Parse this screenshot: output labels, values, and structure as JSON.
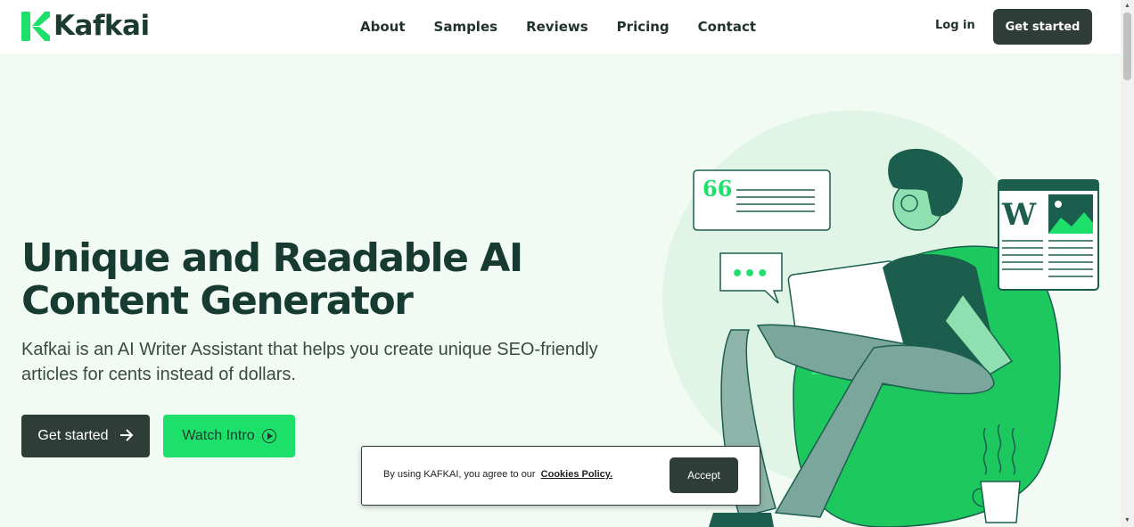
{
  "brand": {
    "name": "Kafkai",
    "accent": "#1de06b",
    "dark": "#2f3d38"
  },
  "nav": {
    "items": [
      {
        "label": "About"
      },
      {
        "label": "Samples"
      },
      {
        "label": "Reviews"
      },
      {
        "label": "Pricing"
      },
      {
        "label": "Contact"
      }
    ],
    "login_label": "Log in",
    "cta_label": "Get started"
  },
  "hero": {
    "title": "Unique and Readable AI Content Generator",
    "subtitle": "Kafkai is an AI Writer Assistant that helps you create unique SEO-friendly articles for cents instead of dollars.",
    "primary_button": "Get started",
    "primary_icon": "arrow-right-icon",
    "secondary_button": "Watch Intro",
    "secondary_icon": "play-circle-icon",
    "illustration": {
      "quote_icon": "66",
      "dots_icon": "•••",
      "document_letter": "W"
    }
  },
  "cookie": {
    "text": "By using KAFKAI, you agree to our",
    "link_label": "Cookies Policy.",
    "accept_label": "Accept"
  }
}
